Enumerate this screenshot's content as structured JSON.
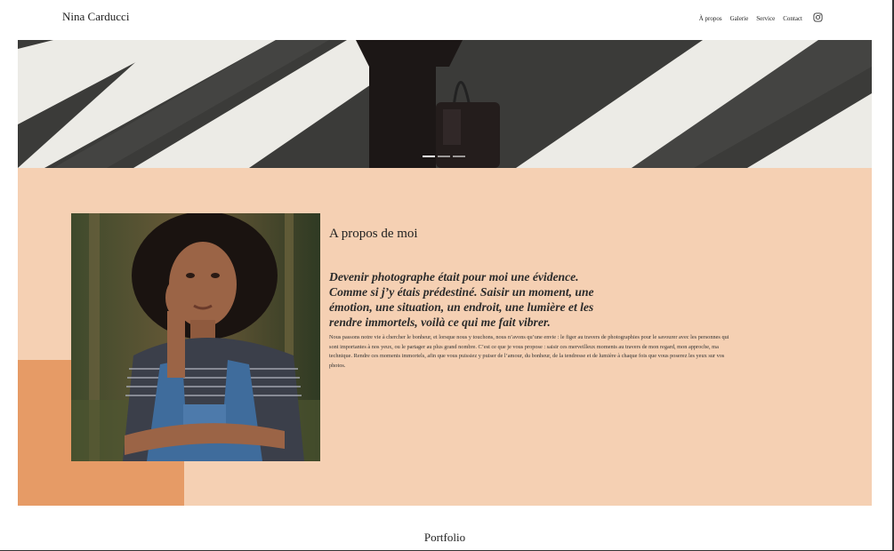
{
  "header": {
    "brand": "Nina Carducci",
    "nav": [
      {
        "label": "À propos"
      },
      {
        "label": "Galerie"
      },
      {
        "label": "Service"
      },
      {
        "label": "Contact"
      }
    ],
    "social_icon": "instagram-icon"
  },
  "carousel": {
    "slide_count": 3,
    "active_slide": 1
  },
  "about": {
    "title": "A propos de moi",
    "lead": "Devenir photographe était pour moi une évidence. Comme si j’y étais prédestiné. Saisir un moment, une émotion, une situation, un endroit, une lumière et les rendre immortels, voilà ce qui me fait vibrer.",
    "body": "Nous passons notre vie à chercher le bonheur, et lorsque nous y touchons, nous n’avons qu’une envie : le figer au travers de photographies pour le savourer avec les personnes qui sont importantes à nos yeux, ou le partager au plus grand nombre. C’est ce que je vous propose : saisir ces merveilleux moments au travers de mon regard, mon approche, ma technique. Rendre ces moments immortels, afin que vous puissiez y puiser de l’amour, du bonheur, de la tendresse et de lumière à chaque fois que vous poserez les yeux sur vos photos."
  },
  "portfolio": {
    "title": "Portfolio"
  },
  "colors": {
    "about_background": "#f5d0b3",
    "accent_block": "#e69b66",
    "text": "#222222"
  }
}
